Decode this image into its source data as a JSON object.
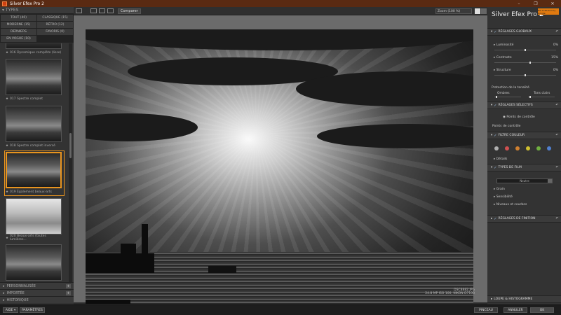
{
  "window": {
    "title": "Silver Efex Pro 2",
    "controls": [
      "–",
      "❐",
      "✕"
    ]
  },
  "left_panel": {
    "header": "TYPES",
    "categories": [
      {
        "label": "TOUT (40)"
      },
      {
        "label": "CLASSIQUE (15)"
      },
      {
        "label": "MODERNE (15)"
      },
      {
        "label": "RÉTRO (12)"
      },
      {
        "label": "DERNIERS"
      },
      {
        "label": "FAVORIS (0)"
      },
      {
        "label": "EN VOGUE (10)"
      }
    ],
    "thumbnails": [
      {
        "caption": "016 Dynamique complète (lisse)"
      },
      {
        "caption": "017 Spectre complet"
      },
      {
        "caption": "018 Spectre complet inversé"
      },
      {
        "caption": "019 Également beaux-arts"
      },
      {
        "caption": "020 Beaux-arts (fautes lumières..."
      },
      {
        "caption": ""
      }
    ],
    "sections": [
      {
        "label": "PERSONNALISÉE"
      },
      {
        "label": "IMPORTÉE"
      },
      {
        "label": "HISTORIQUE"
      }
    ]
  },
  "toolbar": {
    "compare": "Comparer",
    "zoom": "Zoom (100 %)"
  },
  "image_meta": {
    "filename": "DSC8882.JPG",
    "details": "24.8 MP ISO 100, NIKON D7100"
  },
  "right_panel": {
    "brand": "Silver Efex Pro",
    "version": "2",
    "logo_text": "Nik Collection by Google",
    "global": {
      "title": "RÉGLAGES GLOBAUX",
      "brightness": {
        "label": "Luminosité",
        "value": "0%"
      },
      "contrast": {
        "label": "Contraste",
        "value": "15%"
      },
      "structure": {
        "label": "Structure",
        "value": "0%"
      },
      "tonal_protection": "Protection de la tonalité",
      "shadows": "Ombres",
      "highlights": "Tons clairs"
    },
    "selective": {
      "title": "RÉGLAGES SÉLECTIFS",
      "control_points": "Points de contrôle",
      "control_points_sub": "Points de contrôle"
    },
    "color_filter": {
      "title": "FILTRE COULEUR",
      "details": "Détails",
      "colors": [
        "#b0b0b0",
        "#d05050",
        "#d08030",
        "#d0c030",
        "#70b040",
        "#5080d0"
      ]
    },
    "film": {
      "title": "TYPES DE FILM",
      "select": "Neutre",
      "grain": "Grain",
      "sensitivity": "Sensibilité",
      "levels": "Niveaux et courbes"
    },
    "finishing": {
      "title": "RÉGLAGES DE FINITION"
    },
    "loupe": {
      "title": "LOUPE & HISTOGRAMME"
    }
  },
  "bottom": {
    "help": "AIDE ▾",
    "settings": "PARAMÈTRES",
    "brush": "PINCEAU",
    "cancel": "ANNULER",
    "ok": "OK"
  }
}
